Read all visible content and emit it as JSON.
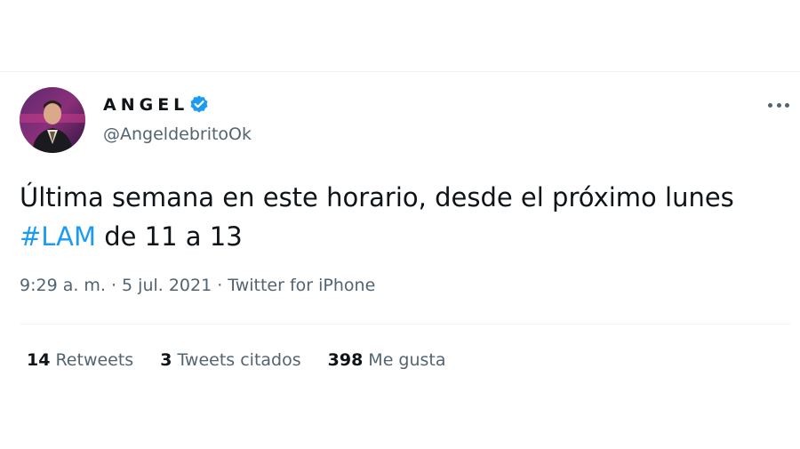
{
  "author": {
    "display_name": "ANGEL",
    "handle": "@AngeldebritoOk",
    "verified": true
  },
  "tweet": {
    "text_line1": "Última semana en este horario, desde el próximo lunes",
    "hashtag": "#LAM",
    "text_line2_rest": " de 11 a 13"
  },
  "meta": {
    "time": "9:29 a. m.",
    "sep1": "·",
    "date": "5 jul. 2021",
    "sep2": "·",
    "source": "Twitter for iPhone"
  },
  "stats": [
    {
      "count": "14",
      "label": "Retweets"
    },
    {
      "count": "3",
      "label": "Tweets citados"
    },
    {
      "count": "398",
      "label": "Me gusta"
    }
  ],
  "icons": {
    "verified": "verified-badge-icon",
    "more": "more-options-icon"
  },
  "colors": {
    "accent": "#1d9bf0",
    "secondary_text": "#536471",
    "primary_text": "#0f1419"
  }
}
